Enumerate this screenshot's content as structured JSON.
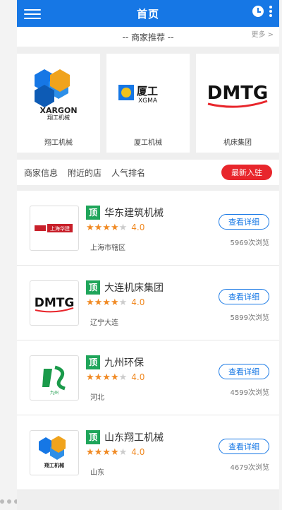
{
  "header": {
    "title": "首页"
  },
  "recommend": {
    "title": "-- 商家推荐 --",
    "more": "更多 >"
  },
  "brands": [
    {
      "logo_text": "XARGON",
      "logo_sub": "翔工机械",
      "name": "翔工机械"
    },
    {
      "logo_text": "厦工",
      "logo_sub": "XGMA",
      "name": "厦工机械"
    },
    {
      "logo_text": "DMTG",
      "name": "机床集团"
    }
  ],
  "tabs": {
    "items": [
      "商家信息",
      "附近的店",
      "人气排名"
    ],
    "badge": "最新入驻"
  },
  "merchants": [
    {
      "badge": "顶",
      "name": "华东建筑机械",
      "rating": "4.0",
      "stars": 4,
      "location": "上海市辖区",
      "views": "5969次浏览",
      "button": "查看详细",
      "logo_text": "上海华建"
    },
    {
      "badge": "顶",
      "name": "大连机床集团",
      "rating": "4.0",
      "stars": 4,
      "location": "辽宁大连",
      "views": "5899次浏览",
      "button": "查看详细",
      "logo_text": "DMTG"
    },
    {
      "badge": "顶",
      "name": "九州环保",
      "rating": "4.0",
      "stars": 4,
      "location": "河北",
      "views": "4599次浏览",
      "button": "查看详细",
      "logo_text": "九州"
    },
    {
      "badge": "顶",
      "name": "山东翔工机械",
      "rating": "4.0",
      "stars": 4,
      "location": "山东",
      "views": "4679次浏览",
      "button": "查看详细",
      "logo_text": "翔工机械"
    }
  ],
  "colors": {
    "primary": "#1677e5",
    "accent_red": "#e8262c",
    "star": "#f08a24",
    "top_badge": "#1fa55a"
  }
}
